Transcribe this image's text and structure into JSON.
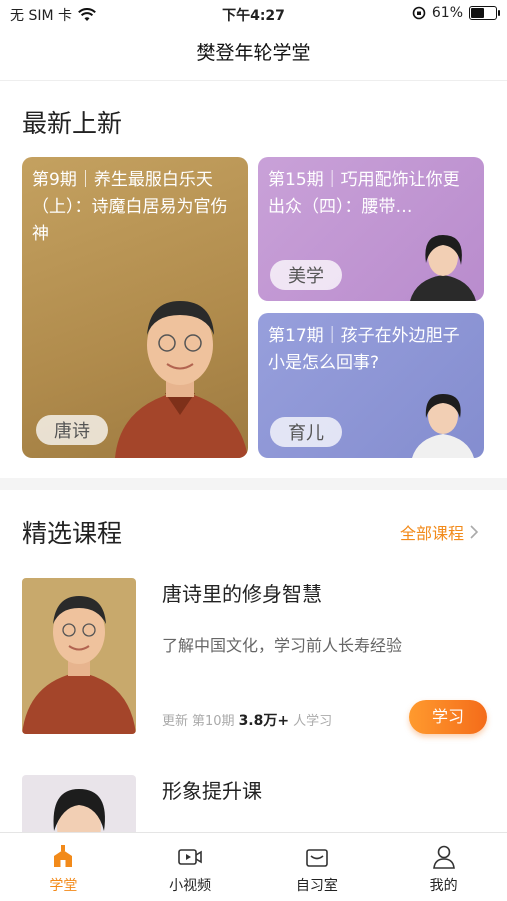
{
  "status_bar": {
    "carrier": "无 SIM 卡",
    "time": "下午4:27",
    "battery": "61%",
    "battery_level": 0.61
  },
  "nav": {
    "title": "樊登年轮学堂"
  },
  "new_section": {
    "title": "最新上新",
    "cards": [
      {
        "text": "第9期｜养生最服白乐天（上）：诗魔白居易为官伤神",
        "tag": "唐诗"
      },
      {
        "text": "第15期｜巧用配饰让你更出众（四）：腰带…",
        "tag": "美学"
      },
      {
        "text": "第17期｜孩子在外边胆子小是怎么回事?",
        "tag": "育儿"
      }
    ]
  },
  "featured": {
    "title": "精选课程",
    "more": "全部课程",
    "courses": [
      {
        "title": "唐诗里的修身智慧",
        "desc": "了解中国文化，学习前人长寿经验",
        "update_prefix": "更新",
        "episode": "第10期",
        "count": "3.8万+",
        "count_suffix": "人学习",
        "button": "学习"
      },
      {
        "title": "形象提升课"
      }
    ]
  },
  "tabbar": {
    "tabs": [
      {
        "label": "学堂",
        "icon": "school-icon",
        "active": true
      },
      {
        "label": "小视频",
        "icon": "video-icon"
      },
      {
        "label": "自习室",
        "icon": "study-room-icon"
      },
      {
        "label": "我的",
        "icon": "profile-icon"
      }
    ]
  },
  "colors": {
    "accent": "#f28a1a",
    "card1": "#b89455",
    "card2": "#c39ad4",
    "card3": "#8e96d6"
  }
}
